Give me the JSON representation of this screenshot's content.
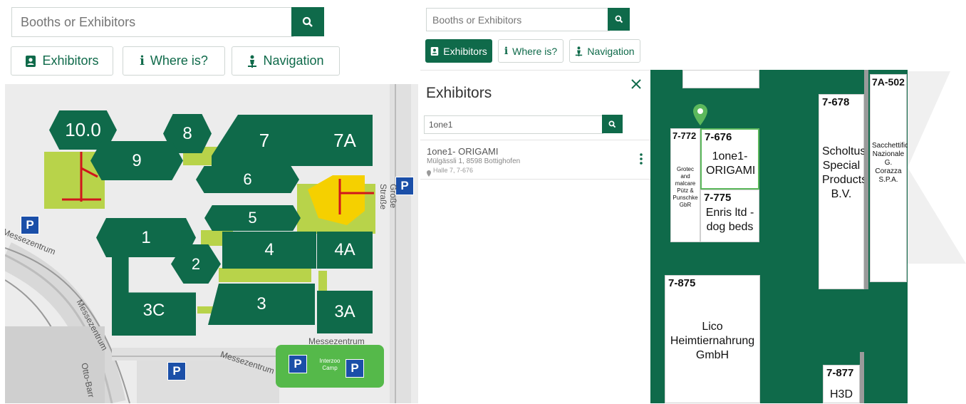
{
  "left": {
    "search": {
      "placeholder": "Booths or Exhibitors"
    },
    "buttons": {
      "exhibitors": "Exhibitors",
      "where_is": "Where is?",
      "navigation": "Navigation"
    },
    "halls": {
      "h10": "10.0",
      "h8": "8",
      "h7": "7",
      "h7a": "7A",
      "h9": "9",
      "h6": "6",
      "h5": "5",
      "h1": "1",
      "h4": "4",
      "h4a": "4A",
      "h2": "2",
      "h3c": "3C",
      "h3": "3",
      "h3a": "3A"
    },
    "streets": {
      "messezentrum_1": "Messezentrum",
      "messezentrum_2": "Messezentrum",
      "messezentrum_3": "Messezentrum",
      "messezentrum_4": "Messezentrum",
      "grosse_strasse": "Große Straße",
      "otto_barr": "Otto-Barr"
    },
    "interzoo": "Interzoo Camp",
    "parking_label": "P"
  },
  "right": {
    "search": {
      "placeholder": "Booths or Exhibitors"
    },
    "buttons": {
      "exhibitors": "Exhibitors",
      "where_is": "Where is?",
      "navigation": "Navigation"
    },
    "panel": {
      "title": "Exhibitors",
      "query": "1one1",
      "result": {
        "name": "1one1- ORIGAMI",
        "address": "Mülgässli 1, 8598 Bottighofen",
        "location": "Halle 7, 7-676"
      }
    },
    "booths": {
      "b7772": {
        "id": "7-772",
        "name": "Grotec and malcare Pütz & Punschke GbR"
      },
      "b7676": {
        "id": "7-676",
        "name": "1one1- ORIGAMI"
      },
      "b7775": {
        "id": "7-775",
        "name": "Enris ltd - dog beds"
      },
      "b7678": {
        "id": "7-678",
        "name": "Scholtus Special Products B.V."
      },
      "b7a502": {
        "id": "7A-502",
        "name": "Sacchettificio Nazionale G. Corazza S.P.A."
      },
      "b7875": {
        "id": "7-875",
        "name": "Lico Heimtiernahrung GmbH"
      },
      "b7877": {
        "id": "7-877",
        "name": "H3D"
      }
    }
  },
  "colors": {
    "brand_green": "#0f6a4a",
    "corridor": "#b8d34a",
    "highlight": "#f5d000",
    "parking": "#1b4fa8"
  }
}
